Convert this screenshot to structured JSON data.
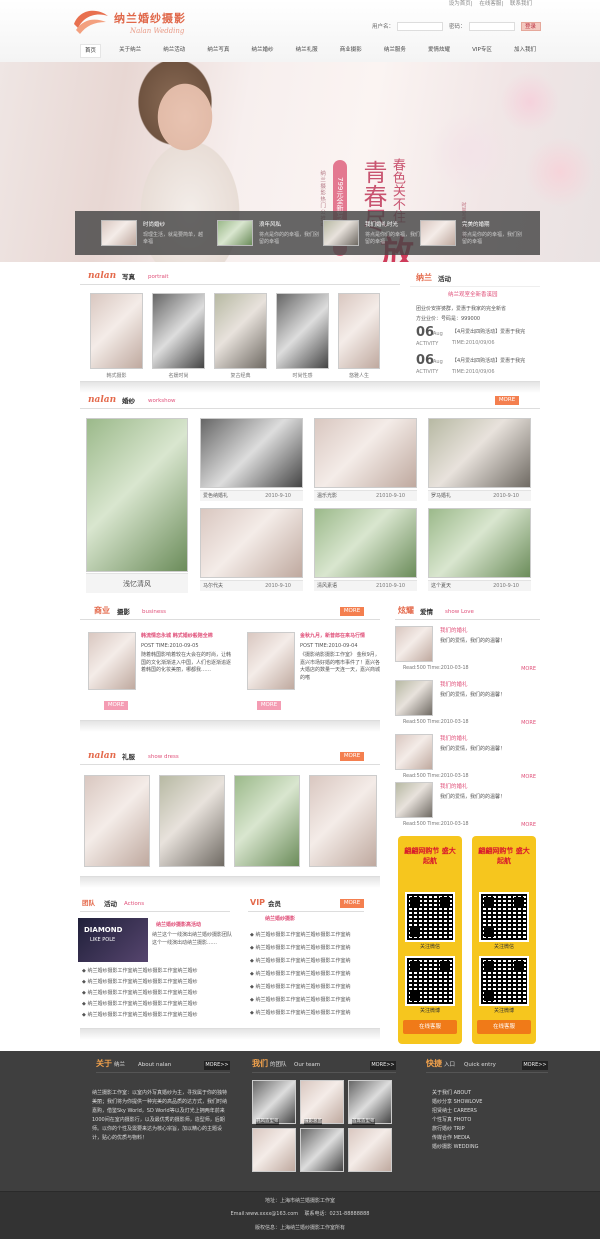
{
  "header": {
    "logo_cn": "纳兰婚纱摄影",
    "logo_en": "Nalan Wedding",
    "links": [
      "设为首页",
      "在线客服",
      "联系我们"
    ],
    "user_label": "用户名：",
    "pass_label": "密码：",
    "login_button": "登录"
  },
  "nav": [
    "首页",
    "关于纳兰",
    "纳兰活动",
    "纳兰写真",
    "纳兰婚纱",
    "纳兰礼服",
    "商业摄影",
    "纳兰服务",
    "爱情炫耀",
    "VIP专区",
    "加入我们"
  ],
  "banner": {
    "promo": "799元全新写真主题",
    "promo_sub": "纳兰摄影热门公推中",
    "big_line1": "青春尽",
    "big_line2": "春色关不住",
    "fang": "放",
    "side": "时尚写真 春之香"
  },
  "strip": [
    {
      "title": "时尚婚纱",
      "text": "现理生活，就是要简单，越幸福"
    },
    {
      "title": "浪年风私",
      "text": "将点是你的的幸福，我们别留的幸福"
    },
    {
      "title": "我们婚礼时光",
      "text": "将点是你们的幸福，我们别留的幸福"
    },
    {
      "title": "完美的婚期",
      "text": "将点是你的的幸福，我们别留的幸福"
    }
  ],
  "portrait": {
    "en": "nalan",
    "cn": "写真",
    "sub": "portrait",
    "captions": [
      "韩式摄影",
      "名媛时尚",
      "复古经典",
      "时尚性感",
      "悠雅人生"
    ]
  },
  "activity": {
    "title_a": "纳兰",
    "title_b": "活动",
    "headline": "纳兰观室全新香溪园",
    "line1": "团业价安拼婆群，爱惠于我家的完全新省",
    "line2": "方业业价：号码是：999000",
    "items": [
      {
        "day": "06",
        "month": "Aug",
        "label": "ACTIVITY",
        "text": "【4月爱出四购活动】爱惠于我完",
        "time": "TIME:2010/09/06"
      },
      {
        "day": "06",
        "month": "Aug",
        "label": "ACTIVITY",
        "text": "【4月爱出四购活动】爱惠于我完",
        "time": "TIME:2010/09/06"
      }
    ]
  },
  "wedding": {
    "en": "nalan",
    "cn": "婚纱",
    "sub": "workshow",
    "more": "MORE",
    "feature": "浅忆清风",
    "items": [
      {
        "name": "爱色纳婚礼",
        "date": "2010-9-10"
      },
      {
        "name": "温乐光影",
        "date": "21010-9-10"
      },
      {
        "name": "罗马婚礼",
        "date": "2010-9-10"
      },
      {
        "name": "马尔代夫",
        "date": "2010-9-10"
      },
      {
        "name": "清风素语",
        "date": "21010-9-10"
      },
      {
        "name": "这个夏天",
        "date": "2010-9-10"
      }
    ]
  },
  "business": {
    "cn_a": "商业",
    "cn_b": "摄影",
    "sub": "business",
    "more": "MORE",
    "posts": [
      {
        "title": "韩流情恋永城  韩式婚纱般陪全棉",
        "date": "POST TIME:2010-09-05",
        "text": "随着韩国影响着较在大会在的时尚，让韩国的文化渐渐进入中国，人们也逐渐追逐着韩国的化妆美丽，哪都我……",
        "more": "MORE"
      },
      {
        "title": "金秋九月，新普郎在来马行情",
        "date": "POST TIME:2010-09-04",
        "text": "《摄影纳影摄影工作室》 金秋9月，嘉兴市场好婚的嗜市事件了！嘉兴各大婚店的数量一天连一天，嘉兴商城的嗜",
        "more": "MORE"
      }
    ]
  },
  "love": {
    "cn_a": "炫耀",
    "cn_b": "爱情",
    "sub": "show Love",
    "items": [
      {
        "title": "我们的婚礼",
        "text": "我们的爱情，我们的的温馨！",
        "read": "Read:500 Time:2010-03-18",
        "more": "MORE"
      },
      {
        "title": "我们的婚礼",
        "text": "我们的爱情，我们的的温馨！",
        "read": "Read:500 Time:2010-03-18",
        "more": "MORE"
      },
      {
        "title": "我们的婚礼",
        "text": "我们的爱情，我们的的温馨！",
        "read": "Read:500 Time:2010-03-18",
        "more": "MORE"
      },
      {
        "title": "我们的婚礼",
        "text": "我们的爱情，我们的的温馨！",
        "read": "Read:500 Time:2010-03-18",
        "more": "MORE"
      }
    ]
  },
  "dress": {
    "en": "nalan",
    "cn": "礼服",
    "sub": "show dress",
    "more": "MORE"
  },
  "team_act": {
    "cn": "团队",
    "cn2": "活动",
    "sub": "Actions",
    "more": "MORE",
    "ad_title": "DIAMOND",
    "ad_sub": "LIKE POLE",
    "headline": "纳兰婚纱摄影高活动",
    "text": "纳兰这个一线演出纳兰婚纱摄影团队这个一线演出动纳兰摄影……",
    "list": [
      "纳兰婚纱摄影工作室纳兰婚纱摄影工作室纳兰婚纱",
      "纳兰婚纱摄影工作室纳兰婚纱摄影工作室纳兰婚纱",
      "纳兰婚纱摄影工作室纳兰婚纱摄影工作室纳兰婚纱",
      "纳兰婚纱摄影工作室纳兰婚纱摄影工作室纳兰婚纱",
      "纳兰婚纱摄影工作室纳兰婚纱摄影工作室纳兰婚纱",
      "纳兰婚纱摄影工作室纳兰婚纱摄影工作室纳兰婚纱"
    ]
  },
  "vip": {
    "cn": "VIP",
    "cn2": "会员",
    "more": "MORE",
    "headline": "纳兰婚纱摄影",
    "list": [
      "纳兰婚纱摄影工作室纳兰婚纱摄影工作室纳",
      "纳兰婚纱摄影工作室纳兰婚纱摄影工作室纳",
      "纳兰婚纱摄影工作室纳兰婚纱摄影工作室纳",
      "纳兰婚纱摄影工作室纳兰婚纱摄影工作室纳",
      "纳兰婚纱摄影工作室纳兰婚纱摄影工作室纳",
      "纳兰婚纱摄影工作室纳兰婚纱摄影工作室纳",
      "纳兰婚纱摄影工作室纳兰婚纱摄影工作室纳"
    ]
  },
  "qr": [
    {
      "head": "翩翩网购节 盛大起航",
      "lbl1": "关注微信",
      "lbl2": "关注微博",
      "foot": "在线客服"
    },
    {
      "head": "翩翩网购节 盛大起航",
      "lbl1": "关注微信",
      "lbl2": "关注微博",
      "foot": "在线客服"
    }
  ],
  "footer": {
    "about_a": "关于",
    "about_b": "纳兰",
    "about_en": "About nalan",
    "team_a": "我们",
    "team_b": "的团队",
    "team_en": "Our team",
    "entry_a": "快捷",
    "entry_b": "入口",
    "entry_en": "Quick entry",
    "more": "MORE>>",
    "about_text": "纳兰摄影工作室：以室内外写真婚纱为主，寻找属于你的独特美丽；我们将为你提供一种完美的高品质的达方式，我们时纳嘉购，借鉴Sky World，SD World等以及灯光上拥两年前来1000间在室内摄影行，以及最优秀的摄影师，造型师，后期师。以你的个性及需要来达为核心宗旨，加以精心的主题设计，贴心的优质与物料！",
    "team_tags": [
      "韩风造型师",
      "摄影总监",
      "首席造型师"
    ],
    "links": [
      "关于我们 ABOUT",
      "婚纱分享 SHOWLOVE",
      "招贤纳士 CAREERS",
      "个性写真 PHOTO",
      "旅行婚纱 TRIP",
      "传媒合作 MEDIA",
      "婚纱摄影 WEDDING"
    ]
  },
  "bottom": {
    "addr": "地址：上海市纳兰婚摄影工作室",
    "email": "Email:www.xxxx@163.com",
    "phone": "联系电话：0231-88888888",
    "copy": "版权信息：上海纳兰婚纱摄影工作室所有"
  }
}
